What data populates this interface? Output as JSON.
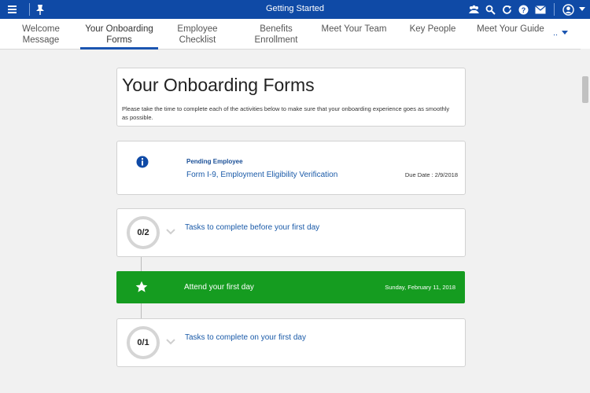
{
  "app": {
    "title": "Getting Started"
  },
  "tabs": [
    {
      "line1": "Welcome",
      "line2": "Message"
    },
    {
      "line1": "Your Onboarding",
      "line2": "Forms"
    },
    {
      "line1": "Employee",
      "line2": "Checklist"
    },
    {
      "line1": "Benefits",
      "line2": "Enrollment"
    },
    {
      "line1": "Meet Your Team",
      "line2": ""
    },
    {
      "line1": "Key People",
      "line2": ""
    },
    {
      "line1": "Meet Your Guide",
      "line2": ""
    }
  ],
  "tabs_more": "..",
  "active_tab": "Your Onboarding Forms",
  "page": {
    "title": "Your Onboarding Forms",
    "intro": "Please take the time to complete each of the activities below to make sure that your onboarding experience goes as smoothly as possible."
  },
  "pending": {
    "label": "Pending Employee",
    "form": "Form I-9, Employment Eligibility Verification",
    "due": "Due Date : 2/9/2018"
  },
  "milestones": {
    "before": {
      "progress": "0/2",
      "text": "Tasks to complete before your first day"
    },
    "firstday": {
      "text": "Attend your first day",
      "date": "Sunday, February 11, 2018"
    },
    "on": {
      "progress": "0/1",
      "text": "Tasks to complete on your first day"
    }
  },
  "colors": {
    "header": "#0f4aa6",
    "accent": "#1b55b0",
    "success": "#159c20"
  },
  "icons": [
    "menu-icon",
    "pin-icon",
    "people-icon",
    "search-icon",
    "refresh-icon",
    "help-icon",
    "mail-icon",
    "user-icon",
    "chevron-down-icon",
    "info-icon",
    "star-icon"
  ]
}
